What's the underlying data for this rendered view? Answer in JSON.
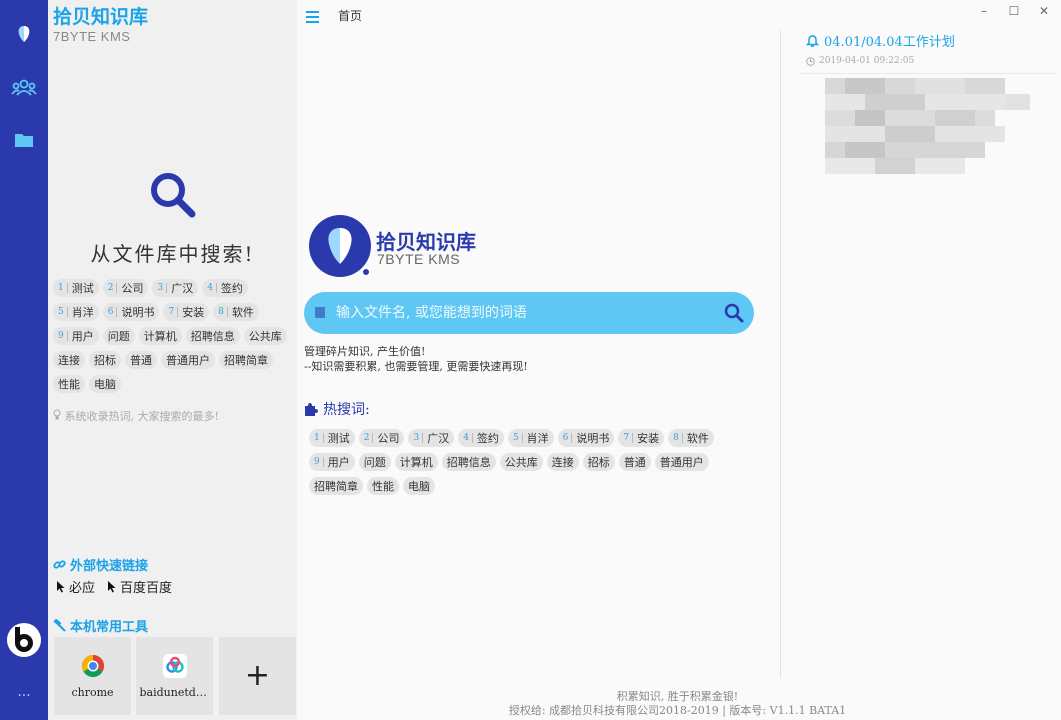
{
  "app": {
    "brand_title": "拾贝知识库",
    "brand_subtitle": "7BYTE KMS",
    "page_title": "首页"
  },
  "panel": {
    "search_title": "从文件库中搜索!",
    "tags": [
      {
        "num": "1",
        "label": "测试"
      },
      {
        "num": "2",
        "label": "公司"
      },
      {
        "num": "3",
        "label": "广汉"
      },
      {
        "num": "4",
        "label": "签约"
      },
      {
        "num": "5",
        "label": "肖洋"
      },
      {
        "num": "6",
        "label": "说明书"
      },
      {
        "num": "7",
        "label": "安装"
      },
      {
        "num": "8",
        "label": "软件"
      },
      {
        "num": "9",
        "label": "用户"
      },
      {
        "num": "",
        "label": "问题"
      },
      {
        "num": "",
        "label": "计算机"
      },
      {
        "num": "",
        "label": "招聘信息"
      },
      {
        "num": "",
        "label": "公共库"
      },
      {
        "num": "",
        "label": "连接"
      },
      {
        "num": "",
        "label": "招标"
      },
      {
        "num": "",
        "label": "普通"
      },
      {
        "num": "",
        "label": "普通用户"
      },
      {
        "num": "",
        "label": "招聘简章"
      },
      {
        "num": "",
        "label": "性能"
      },
      {
        "num": "",
        "label": "电脑"
      }
    ],
    "hint": "系统收录热词, 大家搜索的最多!",
    "external_links_title": "外部快速链接",
    "external_links": [
      "必应",
      "百度百度"
    ],
    "tools_title": "本机常用工具",
    "tools": [
      "chrome",
      "baidunetdisk"
    ],
    "add_tool_symbol": "+"
  },
  "main": {
    "search_placeholder": "输入文件名, 或您能想到的词语",
    "motto_line1": "管理碎片知识, 产生价值!",
    "motto_line2": "--知识需要积累, 也需要管理, 更需要快速再现!",
    "hot_title": "热搜词:",
    "footer_line1": "积累知识, 胜于积累金银!",
    "footer_line2": "授权给: 成都拾贝科技有限公司2018-2019 | 版本号: V1.1.1 BATA1"
  },
  "plan": {
    "title": "04.01/04.04工作计划",
    "timestamp": "2019-04-01 09:22:05"
  },
  "rail": {
    "more_symbol": "···"
  },
  "window": {
    "minimize": "–",
    "maximize": "☐",
    "close": "✕"
  },
  "colors": {
    "rail": "#2a3aad",
    "accent": "#1aa3e8",
    "searchbar": "#5ec7f3",
    "brand_dark": "#2a3aad"
  }
}
